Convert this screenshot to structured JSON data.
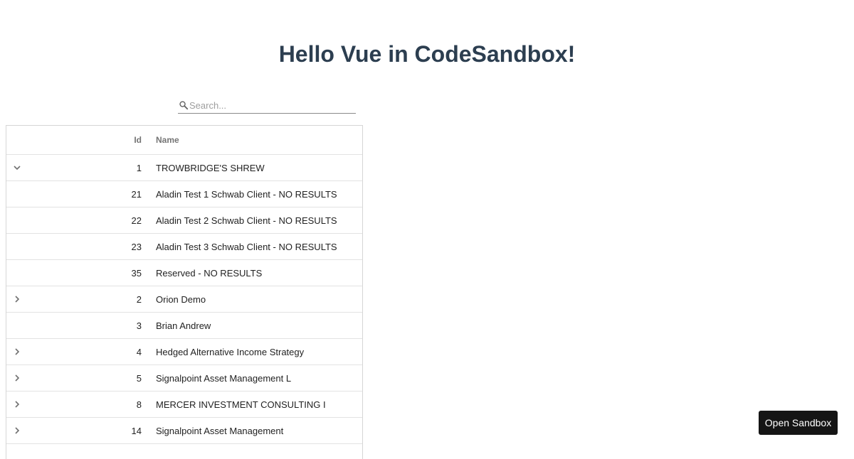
{
  "page": {
    "title": "Hello Vue in CodeSandbox!"
  },
  "search": {
    "placeholder": "Search...",
    "value": "",
    "icon": "search-icon"
  },
  "table": {
    "columns": [
      "",
      "Id",
      "Name"
    ],
    "rows": [
      {
        "expander": "chevron-down-icon",
        "id": "1",
        "name": "TROWBRIDGE'S SHREW"
      },
      {
        "expander": "",
        "id": "21",
        "name": "Aladin Test 1 Schwab Client - NO RESULTS"
      },
      {
        "expander": "",
        "id": "22",
        "name": "Aladin Test 2 Schwab Client - NO RESULTS"
      },
      {
        "expander": "",
        "id": "23",
        "name": "Aladin Test 3 Schwab Client - NO RESULTS"
      },
      {
        "expander": "",
        "id": "35",
        "name": "Reserved - NO RESULTS"
      },
      {
        "expander": "chevron-right-icon",
        "id": "2",
        "name": "Orion Demo"
      },
      {
        "expander": "",
        "id": "3",
        "name": "Brian Andrew"
      },
      {
        "expander": "chevron-right-icon",
        "id": "4",
        "name": "Hedged Alternative Income Strategy"
      },
      {
        "expander": "chevron-right-icon",
        "id": "5",
        "name": "Signalpoint Asset Management L"
      },
      {
        "expander": "chevron-right-icon",
        "id": "8",
        "name": "MERCER INVESTMENT CONSULTING I"
      },
      {
        "expander": "chevron-right-icon",
        "id": "14",
        "name": "Signalpoint Asset Management"
      }
    ]
  },
  "sandbox_button": {
    "label": "Open Sandbox"
  },
  "colors": {
    "title": "#2c3e50",
    "button_bg": "#151515",
    "border": "#e2e2e2"
  }
}
